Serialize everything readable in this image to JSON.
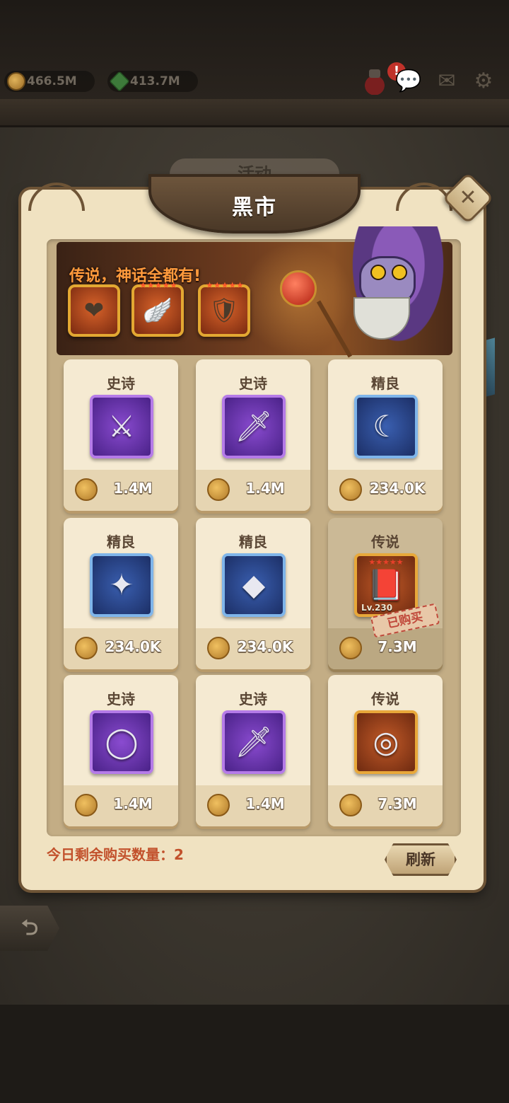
{
  "resources": {
    "gold": "466.5M",
    "gems": "413.7M",
    "alert": "!"
  },
  "background_tab": "活动",
  "panel": {
    "title": "黑市",
    "close_label": "✕"
  },
  "banner": {
    "slogan": "传说，神话全都有!"
  },
  "items": [
    {
      "rarity": "史诗",
      "price": "1.4M",
      "icon": "sickle-blade-icon",
      "tier": "epic",
      "glyph": "⚔"
    },
    {
      "rarity": "史诗",
      "price": "1.4M",
      "icon": "dagger-icon",
      "tier": "epic",
      "glyph": "🗡"
    },
    {
      "rarity": "精良",
      "price": "234.0K",
      "icon": "scythe-icon",
      "tier": "fine",
      "glyph": "☾"
    },
    {
      "rarity": "精良",
      "price": "234.0K",
      "icon": "crystal-staff-icon",
      "tier": "fine",
      "glyph": "✦"
    },
    {
      "rarity": "精良",
      "price": "234.0K",
      "icon": "amulet-icon",
      "tier": "fine",
      "glyph": "◆"
    },
    {
      "rarity": "传说",
      "price": "7.3M",
      "icon": "spellbook-icon",
      "tier": "legend",
      "glyph": "📕",
      "level": "Lv.230",
      "sold_label": "已购买"
    },
    {
      "rarity": "史诗",
      "price": "1.4M",
      "icon": "ring-icon",
      "tier": "epic",
      "glyph": "◯"
    },
    {
      "rarity": "史诗",
      "price": "1.4M",
      "icon": "dagger-icon",
      "tier": "epic",
      "glyph": "🗡"
    },
    {
      "rarity": "传说",
      "price": "7.3M",
      "icon": "legend-ring-icon",
      "tier": "legend",
      "glyph": "◎"
    }
  ],
  "footer": {
    "remaining_label": "今日剩余购买数量：2",
    "refresh_label": "刷新"
  },
  "colors": {
    "panel": "#f0e2c1",
    "accent_text": "#c2512c",
    "epic": "#8a4bd0",
    "fine": "#3a5fb0",
    "legend": "#c25a28"
  }
}
